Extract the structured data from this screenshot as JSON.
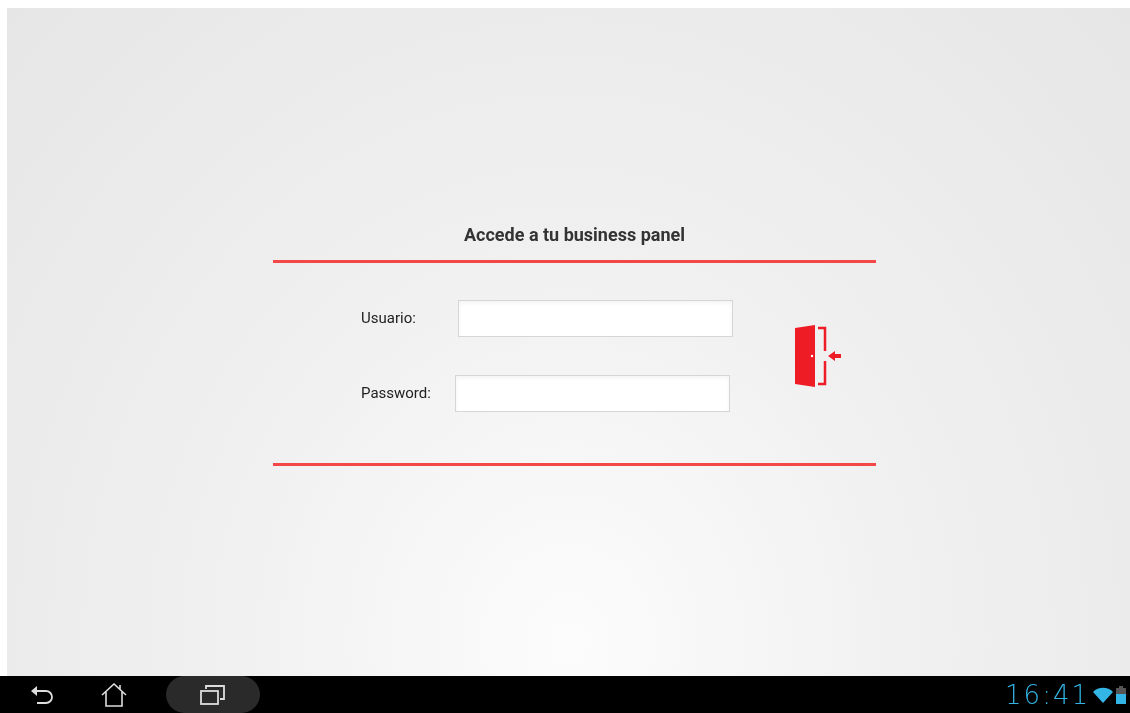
{
  "login": {
    "title": "Accede a tu business panel",
    "fields": [
      {
        "label": "Usuario:"
      },
      {
        "label": "Password:"
      }
    ]
  },
  "status_bar": {
    "time": "16:41"
  }
}
